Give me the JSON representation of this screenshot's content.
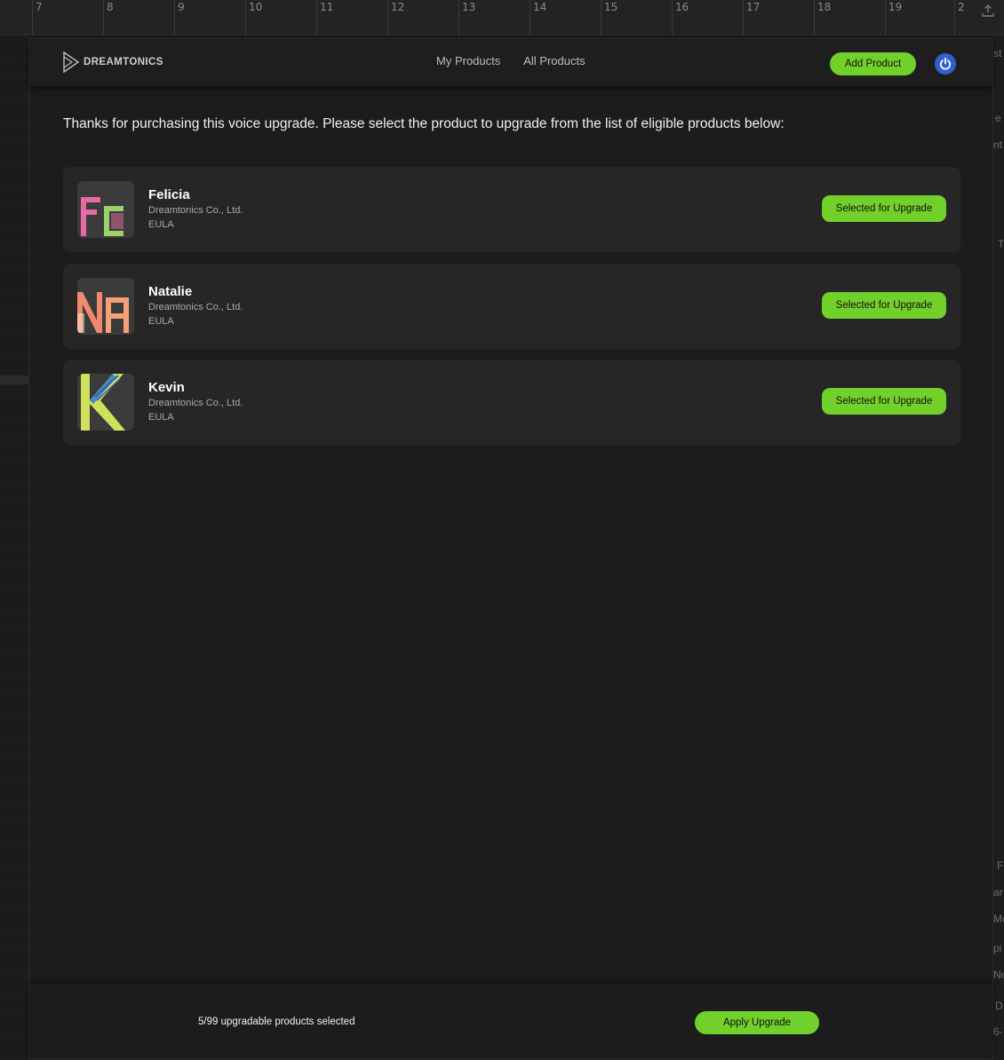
{
  "background": {
    "ruler_marks": [
      "7",
      "8",
      "9",
      "10",
      "11",
      "12",
      "13",
      "14",
      "15",
      "16",
      "17",
      "18",
      "19",
      "2"
    ],
    "right_fragments": [
      "st",
      "e",
      "nt",
      "T",
      "F",
      "ar",
      "Mc",
      "pi",
      "No",
      "D",
      "6-"
    ]
  },
  "topbar": {
    "logo_text": "DREAMTONICS",
    "nav": [
      "My Products",
      "All Products"
    ],
    "add_product_label": "Add Product",
    "power_icon": "power-icon"
  },
  "main": {
    "intro": "Thanks for purchasing this voice upgrade. Please select the product to upgrade from the list of eligible products below:",
    "products": [
      {
        "name": "Felicia",
        "vendor": "Dreamtonics Co., Ltd.",
        "eula": "EULA",
        "button": "Selected for Upgrade",
        "thumb_letters": "Fc",
        "thumb_color": "#e86aa5",
        "thumb_color2": "#9bd16b"
      },
      {
        "name": "Natalie",
        "vendor": "Dreamtonics Co., Ltd.",
        "eula": "EULA",
        "button": "Selected for Upgrade",
        "thumb_letters": "Na",
        "thumb_color": "#f08a6c",
        "thumb_color2": "#ffd1b8"
      },
      {
        "name": "Kevin",
        "vendor": "Dreamtonics Co., Ltd.",
        "eula": "EULA",
        "button": "Selected for Upgrade",
        "thumb_letters": "K",
        "thumb_color": "#cfe05a",
        "thumb_color2": "#3e7fd6"
      }
    ]
  },
  "footer": {
    "count_text": "5/99 upgradable products selected",
    "apply_label": "Apply Upgrade"
  },
  "colors": {
    "accent": "#72d02b",
    "power": "#2f5fd0",
    "card": "#262626",
    "dialog": "#1c1c1c"
  }
}
